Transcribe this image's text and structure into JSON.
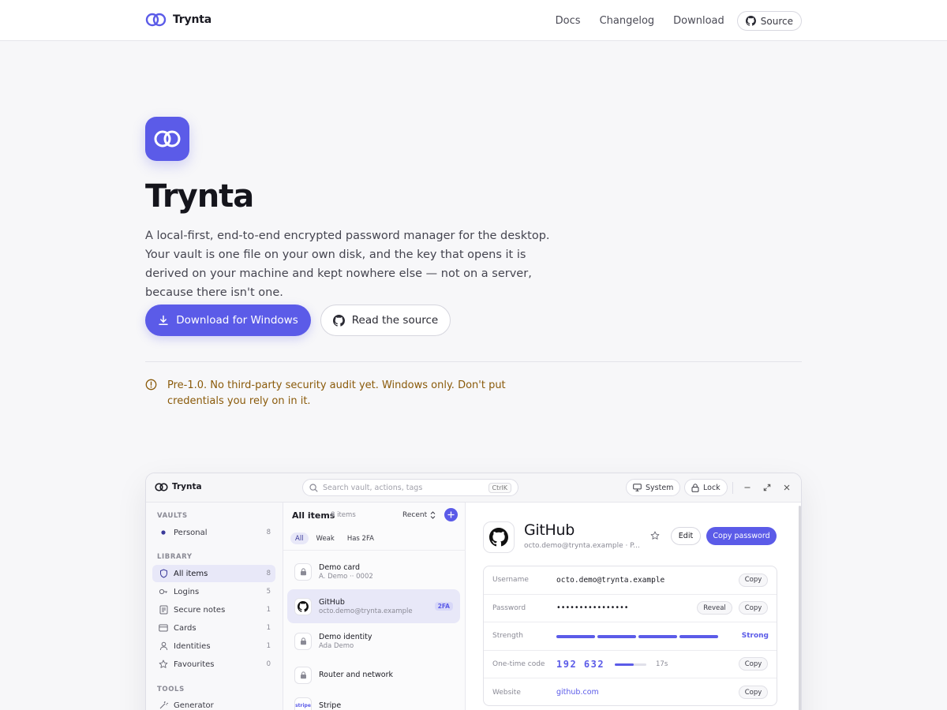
{
  "colors": {
    "accent": "#5b5be8",
    "warning": "#8a5a0a",
    "text": "#1a1a22"
  },
  "nav": {
    "brand": "Trynta",
    "links": [
      "Docs",
      "Changelog",
      "Download"
    ],
    "source_label": "Source"
  },
  "hero": {
    "title": "Trynta",
    "lede": "A local-first, end-to-end encrypted password manager for the desktop. Your vault is one file on your own disk, and the key that opens it is derived on your machine and kept nowhere else — not on a server, because there isn't one.",
    "primary_cta": "Download for Windows",
    "secondary_cta": "Read the source"
  },
  "notice": {
    "icon": "alert-circle-icon",
    "text": "Pre-1.0. No third-party security audit yet. Windows only. Don't put credentials you rely on in it."
  },
  "app": {
    "brand": "Trynta",
    "search_placeholder": "Search vault, actions, tags",
    "search_shortcut": "CtrlK",
    "theme_label": "System",
    "lock_label": "Lock",
    "sidebar": {
      "vaults_heading": "VAULTS",
      "vaults": [
        {
          "label": "Personal",
          "count": "8"
        }
      ],
      "library_heading": "LIBRARY",
      "library": [
        {
          "label": "All items",
          "count": "8",
          "icon": "shield-icon"
        },
        {
          "label": "Logins",
          "count": "5",
          "icon": "key-icon"
        },
        {
          "label": "Secure notes",
          "count": "1",
          "icon": "note-icon"
        },
        {
          "label": "Cards",
          "count": "1",
          "icon": "card-icon"
        },
        {
          "label": "Identities",
          "count": "1",
          "icon": "person-icon"
        },
        {
          "label": "Favourites",
          "count": "0",
          "icon": "star-icon"
        }
      ],
      "tools_heading": "TOOLS",
      "tools": [
        {
          "label": "Generator",
          "icon": "generator-icon"
        }
      ]
    },
    "list": {
      "title": "All items",
      "count": "8 items",
      "sort": "Recent",
      "filters": [
        "All",
        "Weak",
        "Has 2FA"
      ],
      "items": [
        {
          "title": "Demo card",
          "subtitle": "A. Demo ·· 0002",
          "icon": "lock-icon"
        },
        {
          "title": "GitHub",
          "subtitle": "octo.demo@trynta.example",
          "badge": "2FA",
          "icon": "github-icon"
        },
        {
          "title": "Demo identity",
          "subtitle": "Ada Demo",
          "icon": "lock-icon"
        },
        {
          "title": "Router and network",
          "subtitle": "",
          "icon": "lock-icon"
        },
        {
          "title": "Stripe",
          "subtitle": "",
          "icon": "stripe-icon",
          "icon_text": "stripe"
        }
      ]
    },
    "detail": {
      "title": "GitHub",
      "subtitle": "octo.demo@trynta.example · P...",
      "edit": "Edit",
      "copy_password": "Copy password",
      "fields": {
        "username_label": "Username",
        "username_value": "octo.demo@trynta.example",
        "password_label": "Password",
        "password_value": "••••••••••••••••",
        "reveal": "Reveal",
        "strength_label": "Strength",
        "strength_value": "Strong",
        "otp_label": "One-time code",
        "otp_value": "192 632",
        "otp_seconds": "17s",
        "otp_remaining_fraction": 0.6,
        "website_label": "Website",
        "website_value": "github.com",
        "copy": "Copy"
      }
    }
  }
}
